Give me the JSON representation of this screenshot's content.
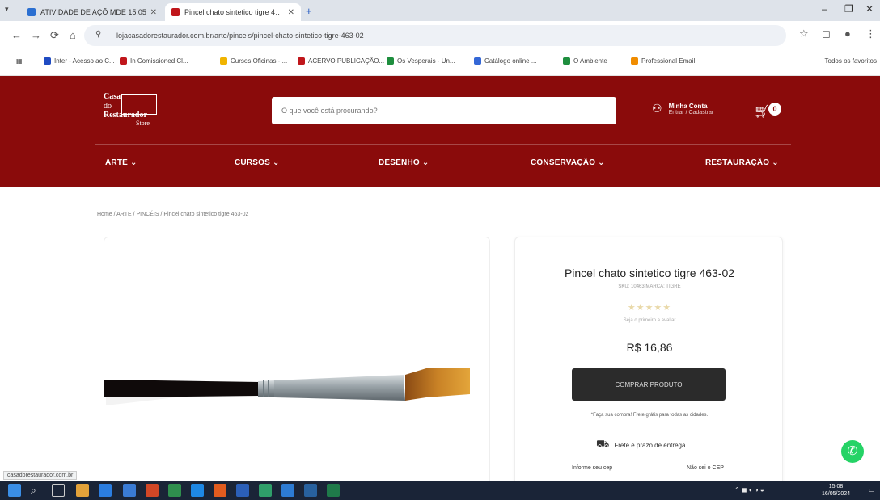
{
  "browser": {
    "tabs": [
      {
        "title": "ATIVIDADE DE AÇÕ MDE 15:05",
        "active": false,
        "favicon_color": "#2b6fd1"
      },
      {
        "title": "Pincel chato sintetico tigre 463-",
        "active": true,
        "favicon_color": "#c0161b"
      }
    ],
    "url": "lojacasadorestaurador.com.br/arte/pinceis/pincel-chato-sintetico-tigre-463-02",
    "bookmarks": [
      {
        "label": "Inter - Acesso ao C...",
        "color": "#1f4bc2"
      },
      {
        "label": "In Comissioned Cl...",
        "color": "#c0161b"
      },
      {
        "label": "Cursos Oficinas - ...",
        "color": "#f0b400"
      },
      {
        "label": "ACERVO PUBLICAÇÃO...",
        "color": "#c0161b"
      },
      {
        "label": "Os Vesperais - Un...",
        "color": "#1e8e3e"
      },
      {
        "label": "Catálogo online ...",
        "color": "#3467d6"
      },
      {
        "label": "O Ambiente",
        "color": "#1e8e3e"
      },
      {
        "label": "Professional Email",
        "color": "#f08c00"
      }
    ],
    "bookmarks_right": "Todos os favoritos"
  },
  "store": {
    "logo": {
      "line1": "Casa",
      "line2": "do",
      "line3": "Restaurador",
      "line4": "Store"
    },
    "search_placeholder": "O que você está procurando?",
    "account": {
      "line1": "Minha Conta",
      "line2": "Entrar / Cadastrar"
    },
    "cart_count": "0",
    "nav": [
      "ARTE",
      "CURSOS",
      "DESENHO",
      "CONSERVAÇÃO",
      "RESTAURAÇÃO"
    ]
  },
  "breadcrumb": "Home / ARTE / PINCÉIS / Pincel chato sintetico tigre 463-02",
  "product": {
    "title": "Pincel chato sintetico tigre 463-02",
    "sku": "SKU: 10463    MARCA: TIGRE",
    "stars": "★★★★★",
    "reviews": "Seja o primeiro a avaliar",
    "price": "R$ 16,86",
    "buy_label": "COMPRAR PRODUTO",
    "notice": "*Faça sua compra! Frete grátis para todas as cidades.",
    "shipping_label": "Frete e prazo de entrega",
    "cep_label": "Informe seu cep",
    "cep_link": "Não sei o CEP"
  },
  "status_url": "casadorestaurador.com.br",
  "taskbar": {
    "time": "15:08",
    "date": "16/05/2024"
  }
}
